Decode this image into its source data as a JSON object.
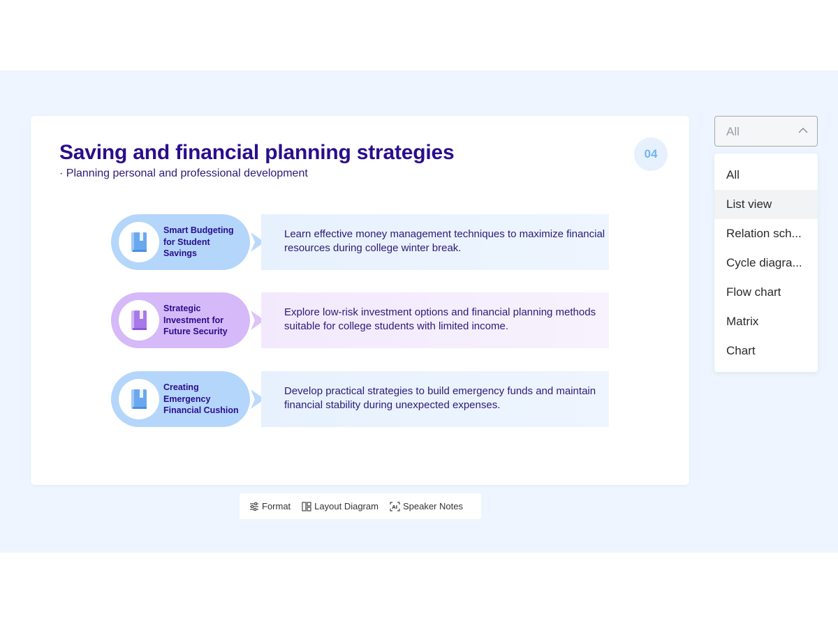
{
  "slide": {
    "title": "Saving and financial planning strategies",
    "subtitle": "· Planning personal and professional development",
    "page_number": "04",
    "items": [
      {
        "label": "Smart Budgeting for Student Savings",
        "description": "Learn effective money management techniques to maximize financial resources during college winter break.",
        "theme": "blue",
        "icon": "book-icon"
      },
      {
        "label": "Strategic Investment for Future Security",
        "description": "Explore low-risk investment options and financial planning methods suitable for college students with limited income.",
        "theme": "purple",
        "icon": "book-icon"
      },
      {
        "label": "Creating Emergency Financial Cushion",
        "description": "Develop practical strategies to build emergency funds and maintain financial stability during unexpected expenses.",
        "theme": "blue",
        "icon": "book-icon"
      }
    ]
  },
  "toolbar": {
    "format": "Format",
    "layout_diagram": "Layout Diagram",
    "speaker_notes": "Speaker Notes"
  },
  "layout_filter": {
    "selected": "All",
    "options": [
      "All",
      "List view",
      "Relation sch...",
      "Cycle diagra...",
      "Flow chart",
      "Matrix",
      "Chart"
    ],
    "hovered_option": "List view"
  },
  "colors": {
    "title": "#2a0d8c",
    "blue_pill": "#b4d6fb",
    "purple_pill": "#d6b9f8",
    "workspace_bg": "#eef5fe"
  }
}
